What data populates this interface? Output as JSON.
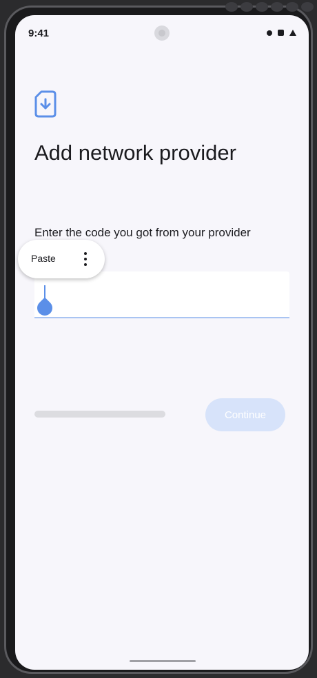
{
  "status_bar": {
    "time": "9:41"
  },
  "header": {
    "icon": "sim-download-icon",
    "title": "Add network provider"
  },
  "body": {
    "instruction": "Enter the code you got from your provider"
  },
  "code_input": {
    "value": "",
    "placeholder": ""
  },
  "context_menu": {
    "paste_label": "Paste",
    "more_icon": "more-vertical-icon"
  },
  "actions": {
    "continue_label": "Continue",
    "continue_enabled": false
  },
  "colors": {
    "accent": "#5b8fe8",
    "button_disabled": "#d7e3fa",
    "background": "#f7f6fb"
  }
}
